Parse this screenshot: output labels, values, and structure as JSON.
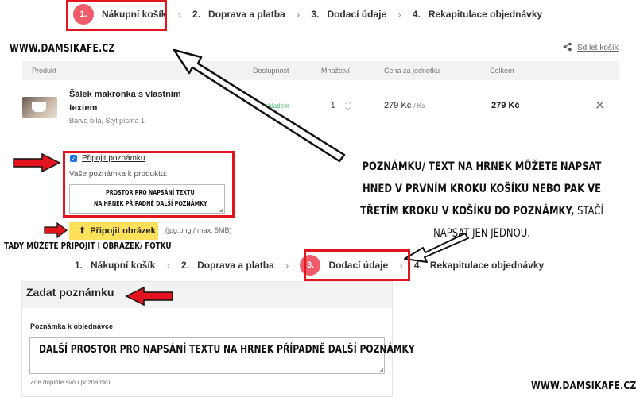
{
  "brand": "WWW.DAMSIKAFE.CZ",
  "steps_top": [
    {
      "num": "1.",
      "label": "Nákupní košík"
    },
    {
      "num": "2.",
      "label": "Doprava a platba"
    },
    {
      "num": "3.",
      "label": "Dodací údaje"
    },
    {
      "num": "4.",
      "label": "Rekapitulace objednávky"
    }
  ],
  "steps_bottom": [
    {
      "num": "1.",
      "label": "Nákupní košík"
    },
    {
      "num": "2.",
      "label": "Doprava a platba"
    },
    {
      "num": "3.",
      "label": "Dodací údaje"
    },
    {
      "num": "4.",
      "label": "Rekapitulace objednávky"
    }
  ],
  "share_label": "Sdílet košík",
  "table_headers": {
    "product": "Produkt",
    "availability": "Dostupnost",
    "quantity": "Množství",
    "unit_price": "Cena za jednotku",
    "total": "Celkem"
  },
  "item": {
    "name_line1": "Šálek makronka s vlastním",
    "name_line2": "textem",
    "variant": "Barva bílá, Styl písma 1",
    "availability": "Bílá skladem",
    "quantity": "1",
    "unit_price": "279 Kč",
    "unit": "/ Ks",
    "total": "279 Kč"
  },
  "note": {
    "checkbox_label": "Připojit poznámku",
    "product_note_label": "Vaše poznámka k produktu:",
    "product_note_line1": "PROSTOR PRO NAPSÁNÍ TEXTU",
    "product_note_line2": "NA HRNEK PŘÍPADNĚ DALŠÍ POZNÁMKY"
  },
  "attach": {
    "button_label": "Připojit obrázek",
    "hint": "(jpg,png / max. 5MB)"
  },
  "annotation_main_bold": "POZNÁMKU/ TEXT NA HRNEK MŮŽETE NAPSAT HNED V PRVNÍM KROKU KOŠÍKU NEBO PAK  VE TŘETÍM KROKU V KOŠÍKU DO POZNÁMKY,",
  "annotation_main_rest": " STAČÍ NAPSAT JEN JEDNOU.",
  "annotation_image": "TADY MŮŽETE PŘIPOJIT I OBRÁZEK/ FOTKU",
  "order_note": {
    "heading": "Zadat poznámku",
    "label": "Poznámka k objednávce",
    "value": "DALŠÍ PROSTOR PRO NAPSÁNÍ TEXTU NA HRNEK PŘÍPADNĚ DALŠÍ POZNÁMKY",
    "hint": "Zde doplňte svou poznámku"
  },
  "colors": {
    "accent": "#ef5b6a",
    "highlight": "#e3141d",
    "green": "#3cb371",
    "button": "#fde15b"
  }
}
